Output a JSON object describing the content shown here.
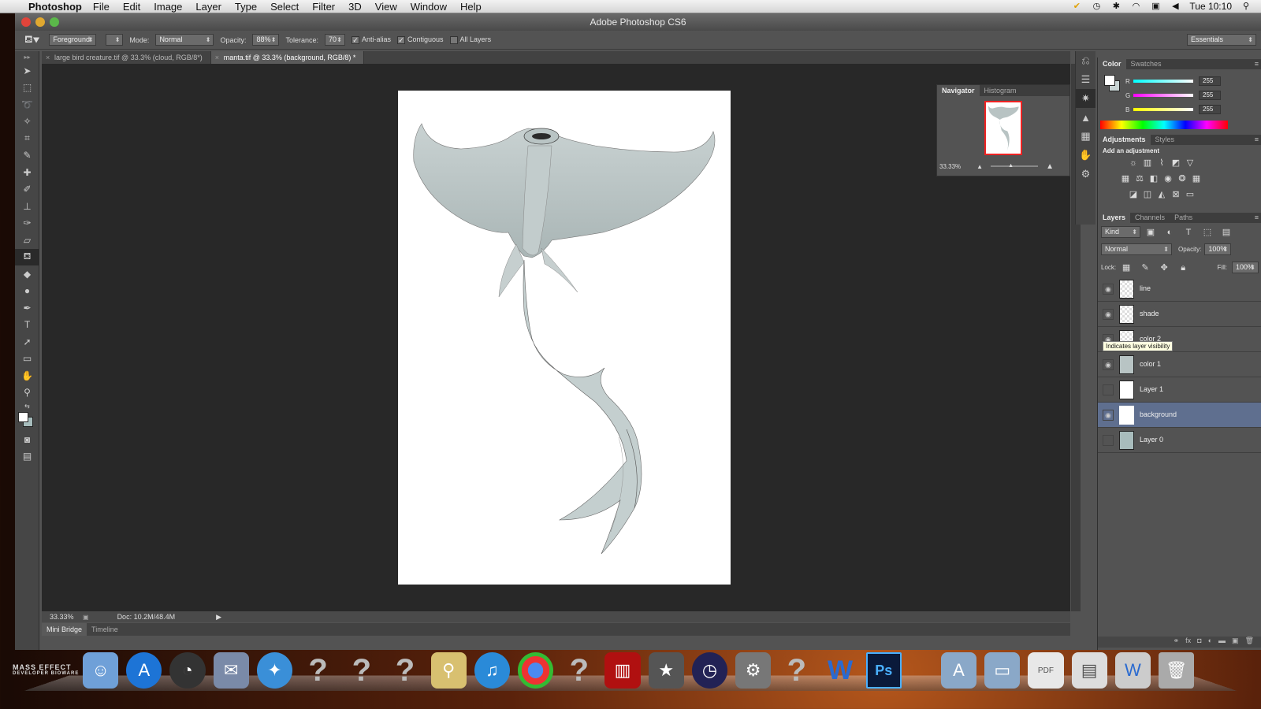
{
  "menubar": {
    "app_name": "Photoshop",
    "items": [
      "File",
      "Edit",
      "Image",
      "Layer",
      "Type",
      "Select",
      "Filter",
      "3D",
      "View",
      "Window",
      "Help"
    ],
    "clock": "Tue 10:10"
  },
  "window": {
    "title": "Adobe Photoshop CS6"
  },
  "options": {
    "fill_source": "Foreground",
    "mode_label": "Mode:",
    "mode_value": "Normal",
    "opacity_label": "Opacity:",
    "opacity_value": "88%",
    "tolerance_label": "Tolerance:",
    "tolerance_value": "70",
    "anti_alias": "Anti-alias",
    "contiguous": "Contiguous",
    "all_layers": "All Layers",
    "workspace": "Essentials"
  },
  "doc_tabs": [
    {
      "label": "large bird creature.tif @ 33.3% (cloud, RGB/8*)",
      "active": false
    },
    {
      "label": "manta.tif @ 33.3% (background, RGB/8) *",
      "active": true
    }
  ],
  "status": {
    "zoom": "33.33%",
    "doc": "Doc: 10.2M/48.4M"
  },
  "bottom_tabs": [
    "Mini Bridge",
    "Timeline"
  ],
  "navigator": {
    "tabs": [
      "Navigator",
      "Histogram"
    ],
    "zoom": "33.33%"
  },
  "color_panel": {
    "tabs": [
      "Color",
      "Swatches"
    ],
    "channels": [
      {
        "label": "R",
        "value": "255"
      },
      {
        "label": "G",
        "value": "255"
      },
      {
        "label": "B",
        "value": "255"
      }
    ]
  },
  "adjustments": {
    "tabs": [
      "Adjustments",
      "Styles"
    ],
    "hint": "Add an adjustment"
  },
  "layers_panel": {
    "tabs": [
      "Layers",
      "Channels",
      "Paths"
    ],
    "kind": "Kind",
    "blend": "Normal",
    "opacity_label": "Opacity:",
    "opacity_value": "100%",
    "lock_label": "Lock:",
    "fill_label": "Fill:",
    "fill_value": "100%",
    "layers": [
      {
        "name": "line",
        "visible": true,
        "selected": false
      },
      {
        "name": "shade",
        "visible": true,
        "selected": false
      },
      {
        "name": "color 2",
        "visible": true,
        "selected": false
      },
      {
        "name": "color 1",
        "visible": true,
        "selected": false
      },
      {
        "name": "Layer 1",
        "visible": false,
        "selected": false
      },
      {
        "name": "background",
        "visible": true,
        "selected": true
      },
      {
        "name": "Layer 0",
        "visible": false,
        "selected": false
      }
    ],
    "tooltip": "Indicates layer visibility"
  },
  "desktop": {
    "badge_line1": "MASS EFFECT",
    "badge_line2": "DEVELOPER BIOWARE"
  },
  "colors": {
    "panel": "#535353",
    "canvas_bg": "#282828",
    "selection": "#5f6f8f"
  }
}
